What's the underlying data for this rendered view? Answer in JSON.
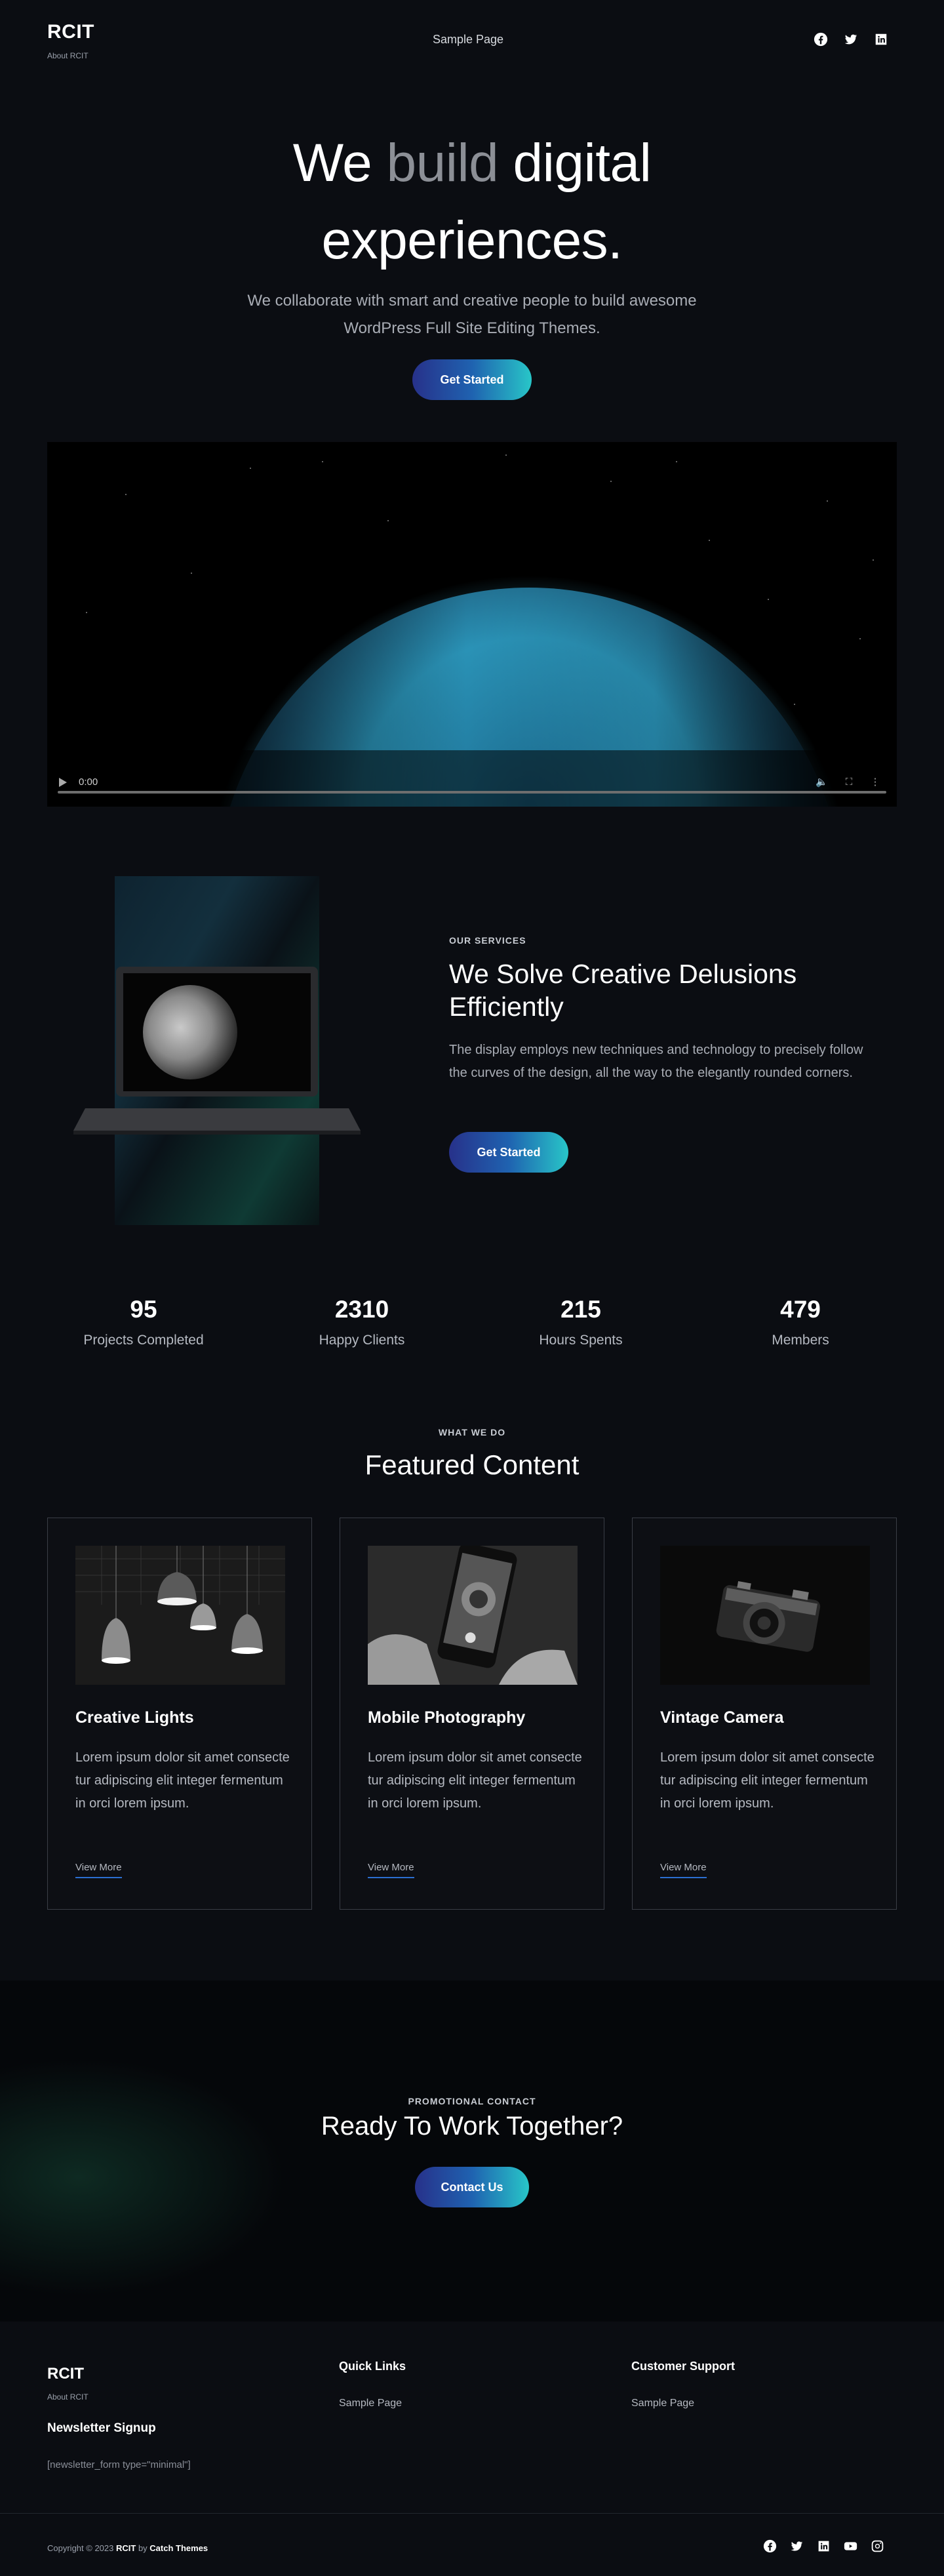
{
  "header": {
    "site_title": "RCIT",
    "tagline": "About RCIT",
    "nav": [
      "Sample Page"
    ],
    "social": [
      "facebook-icon",
      "twitter-icon",
      "linkedin-icon"
    ]
  },
  "hero": {
    "title_part1": "We ",
    "title_highlight": "build",
    "title_part2": " digital",
    "title_line2": "experiences.",
    "subtitle": "We collaborate with smart and creative people to build awesome WordPress Full Site Editing Themes.",
    "button": "Get Started"
  },
  "video": {
    "time": "0:00",
    "progress": 0
  },
  "services": {
    "eyebrow": "OUR SERVICES",
    "title": "We Solve Creative Delusions Efficiently",
    "text": "The display employs new techniques and technology to precisely follow the curves of the design, all the way to the elegantly rounded corners.",
    "button": "Get Started"
  },
  "stats": [
    {
      "number": "95",
      "label": "Projects Completed"
    },
    {
      "number": "2310",
      "label": "Happy Clients"
    },
    {
      "number": "215",
      "label": "Hours Spents"
    },
    {
      "number": "479",
      "label": "Members"
    }
  ],
  "featured": {
    "eyebrow": "WHAT WE DO",
    "title": "Featured Content",
    "cards": [
      {
        "title": "Creative Lights",
        "text": "Lorem ipsum dolor sit amet consecte tur adipiscing elit integer fermentum in orci lorem ipsum.",
        "link": "View More"
      },
      {
        "title": "Mobile Photography",
        "text": "Lorem ipsum dolor sit amet consecte tur adipiscing elit integer fermentum in orci lorem ipsum.",
        "link": "View More"
      },
      {
        "title": "Vintage Camera",
        "text": "Lorem ipsum dolor sit amet consecte tur adipiscing elit integer fermentum in orci lorem ipsum.",
        "link": "View More"
      }
    ]
  },
  "promo": {
    "eyebrow": "PROMOTIONAL CONTACT",
    "title": "Ready To Work Together?",
    "button": "Contact Us"
  },
  "footer": {
    "site_title": "RCIT",
    "tagline": "About RCIT",
    "newsletter_heading": "Newsletter Signup",
    "newsletter_shortcode": "[newsletter_form type=\"minimal\"]",
    "quick_links_heading": "Quick Links",
    "quick_links": [
      "Sample Page"
    ],
    "support_heading": "Customer Support",
    "support_links": [
      "Sample Page"
    ],
    "copyright_prefix": "Copyright © 2023 ",
    "copyright_site": "RCIT",
    "copyright_by": " by ",
    "copyright_author": "Catch Themes",
    "social": [
      "facebook-icon",
      "twitter-icon",
      "linkedin-icon",
      "youtube-icon",
      "instagram-icon"
    ]
  },
  "colors": {
    "background": "#0b0d12",
    "button_gradient_start": "#27318a",
    "button_gradient_end": "#28c6c8",
    "link_underline": "#2b6fd1"
  }
}
